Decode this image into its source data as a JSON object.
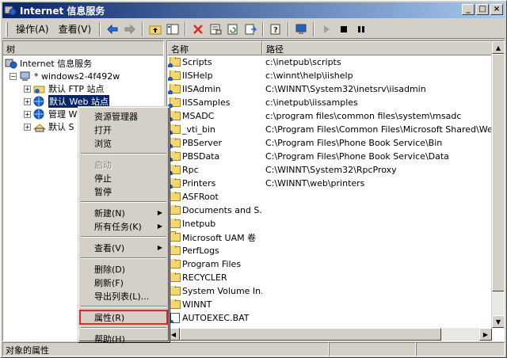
{
  "window": {
    "title": "Internet 信息服务",
    "controls": {
      "minimize": "_",
      "maximize": "□",
      "close": "×"
    }
  },
  "menubar": {
    "action": "操作(A)",
    "view": "查看(V)"
  },
  "tree_pane": {
    "tab_label": "树",
    "root": "Internet 信息服务",
    "server": "* windows2-4f492w",
    "items": [
      {
        "label": "默认 FTP 站点",
        "expander": "+"
      },
      {
        "label": "默认 Web 站点",
        "expander": "+",
        "selected": true
      },
      {
        "label": "管理 W",
        "expander": "+"
      },
      {
        "label": "默认 S",
        "expander": "+"
      }
    ]
  },
  "list_pane": {
    "columns": [
      "名称",
      "路径"
    ],
    "rows": [
      {
        "name": "Scripts",
        "path": "c:\\inetpub\\scripts",
        "icon": "web-folder-icon"
      },
      {
        "name": "IISHelp",
        "path": "c:\\winnt\\help\\iishelp",
        "icon": "web-folder-icon"
      },
      {
        "name": "IISAdmin",
        "path": "C:\\WINNT\\System32\\inetsrv\\iisadmin",
        "icon": "web-folder-icon"
      },
      {
        "name": "IISSamples",
        "path": "c:\\inetpub\\iissamples",
        "icon": "web-folder-icon"
      },
      {
        "name": "MSADC",
        "path": "c:\\program files\\common files\\system\\msadc",
        "icon": "web-folder-icon"
      },
      {
        "name": "_vti_bin",
        "path": "C:\\Program Files\\Common Files\\Microsoft Shared\\Web Se...",
        "icon": "web-folder-icon"
      },
      {
        "name": "PBServer",
        "path": "C:\\Program Files\\Phone Book Service\\Bin",
        "icon": "web-folder-icon"
      },
      {
        "name": "PBSData",
        "path": "C:\\Program Files\\Phone Book Service\\Data",
        "icon": "web-folder-icon"
      },
      {
        "name": "Rpc",
        "path": "C:\\WINNT\\System32\\RpcProxy",
        "icon": "web-folder-icon"
      },
      {
        "name": "Printers",
        "path": "C:\\WINNT\\web\\printers",
        "icon": "web-folder-icon"
      },
      {
        "name": "ASFRoot",
        "path": "",
        "icon": "folder-icon"
      },
      {
        "name": "Documents and S...",
        "path": "",
        "icon": "folder-icon"
      },
      {
        "name": "Inetpub",
        "path": "",
        "icon": "folder-icon"
      },
      {
        "name": "Microsoft UAM 卷",
        "path": "",
        "icon": "folder-icon"
      },
      {
        "name": "PerfLogs",
        "path": "",
        "icon": "folder-icon"
      },
      {
        "name": "Program Files",
        "path": "",
        "icon": "folder-icon"
      },
      {
        "name": "RECYCLER",
        "path": "",
        "icon": "folder-icon"
      },
      {
        "name": "System Volume In...",
        "path": "",
        "icon": "folder-icon"
      },
      {
        "name": "WINNT",
        "path": "",
        "icon": "folder-icon"
      },
      {
        "name": "AUTOEXEC.BAT",
        "path": "",
        "icon": "file-icon"
      }
    ]
  },
  "context_menu": {
    "groups": [
      [
        {
          "label": "资源管理器"
        },
        {
          "label": "打开"
        },
        {
          "label": "浏览"
        }
      ],
      [
        {
          "label": "启动",
          "disabled": true
        },
        {
          "label": "停止"
        },
        {
          "label": "暂停"
        }
      ],
      [
        {
          "label": "新建(N)",
          "submenu": true
        },
        {
          "label": "所有任务(K)",
          "submenu": true
        }
      ],
      [
        {
          "label": "查看(V)",
          "submenu": true
        }
      ],
      [
        {
          "label": "删除(D)"
        },
        {
          "label": "刷新(F)"
        },
        {
          "label": "导出列表(L)..."
        }
      ],
      [
        {
          "label": "属性(R)",
          "highlighted": true
        }
      ],
      [
        {
          "label": "帮助(H)"
        }
      ]
    ]
  },
  "statusbar": {
    "text": "对象的属性"
  }
}
